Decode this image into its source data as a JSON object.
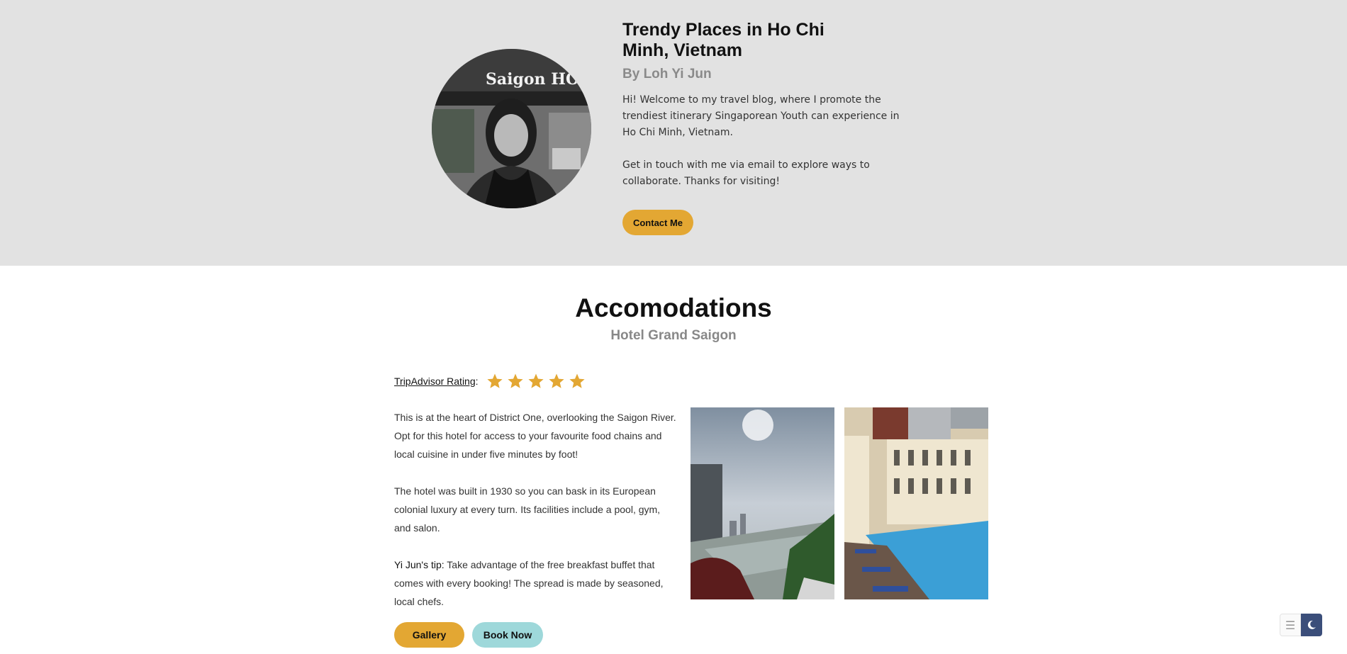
{
  "hero": {
    "title": "Trendy Places in Ho Chi Minh, Vietnam",
    "author": "By Loh Yi Jun",
    "bio": "Hi! Welcome to my travel blog, where I promote the trendiest itinerary Singaporean Youth can experience in Ho Chi Minh, Vietnam.\n\nGet in touch with me via email to explore ways to collaborate. Thanks for visiting!",
    "contact_label": "Contact Me",
    "avatar_sign": "Saigon HOLIDAY"
  },
  "section": {
    "title": "Accomodations",
    "subtitle": "Hotel Grand Saigon"
  },
  "rating": {
    "label": "TripAdvisor Rating",
    "colon": ":",
    "stars": 5,
    "star_color": "#e3a733"
  },
  "body": {
    "p1": "This is at the heart of District One, overlooking the Saigon River. Opt for this hotel for access to your favourite food chains and local cuisine in under five minutes by foot!",
    "p2": "The hotel was built in 1930 so you can bask in its European colonial luxury at every turn. Its facilities include a pool, gym, and salon.",
    "tip_label": "Yi Jun's tip:",
    "tip_text": " Take advantage of the free breakfast buffet that comes with every booking! The spread is made by seasoned, local chefs."
  },
  "buttons": {
    "gallery": "Gallery",
    "book": "Book Now"
  },
  "colors": {
    "hero_bg": "#e2e2e2",
    "accent": "#e3a733",
    "secondary": "#9ed8da",
    "widget": "#3b4e7a"
  },
  "icons": {
    "menu": "menu-icon",
    "moon": "moon-icon",
    "star": "star-icon"
  }
}
